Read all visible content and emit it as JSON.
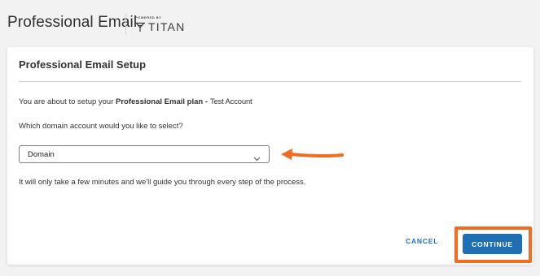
{
  "header": {
    "title": "Professional Email",
    "powered_by": "POWERED BY",
    "brand": "TITAN"
  },
  "card": {
    "title": "Professional Email Setup",
    "intro_prefix": "You are about to setup your ",
    "plan_name": "Professional Email plan -",
    "account_name": "Test Account",
    "question": "Which domain account would you like to select?",
    "domain_select": {
      "selected": "Domain"
    },
    "helper": "It will only take a few minutes and we'll guide you through every step of the process."
  },
  "actions": {
    "cancel_label": "CANCEL",
    "continue_label": "CONTINUE"
  },
  "colors": {
    "primary": "#1f6fb5",
    "annotation": "#f26b21",
    "background": "#f2f2f3"
  }
}
